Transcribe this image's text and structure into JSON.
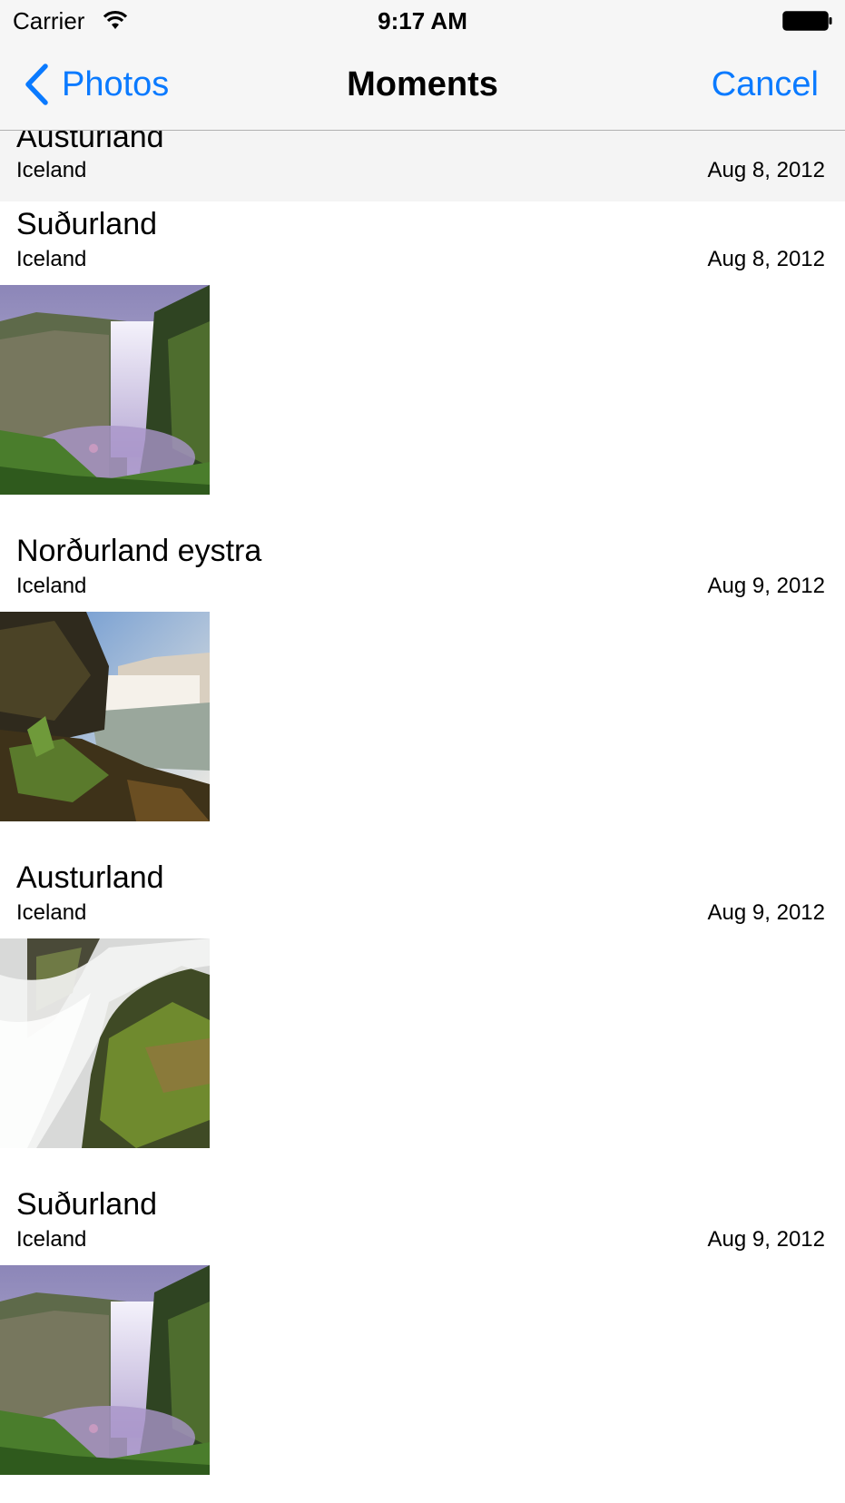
{
  "status_bar": {
    "carrier": "Carrier",
    "time": "9:17 AM",
    "wifi_icon": "wifi-icon",
    "battery_icon": "battery-icon"
  },
  "nav_bar": {
    "back_label": "Photos",
    "back_icon": "chevron-left-icon",
    "title": "Moments",
    "cancel_label": "Cancel",
    "tint_color": "#0a7aff"
  },
  "sticky_header": {
    "title": "Austurland",
    "place": "Iceland",
    "date": "Aug 8, 2012"
  },
  "moments": [
    {
      "title": "Suðurland",
      "place": "Iceland",
      "date": "Aug 8, 2012",
      "photo": "skogafoss-waterfall"
    },
    {
      "title": "Norðurland eystra",
      "place": "Iceland",
      "date": "Aug 9, 2012",
      "photo": "godafoss-waterfall"
    },
    {
      "title": "Austurland",
      "place": "Iceland",
      "date": "Aug 9, 2012",
      "photo": "cascade-over-mossy-rocks"
    },
    {
      "title": "Suðurland",
      "place": "Iceland",
      "date": "Aug 9, 2012",
      "photo": "skogafoss-waterfall"
    }
  ]
}
